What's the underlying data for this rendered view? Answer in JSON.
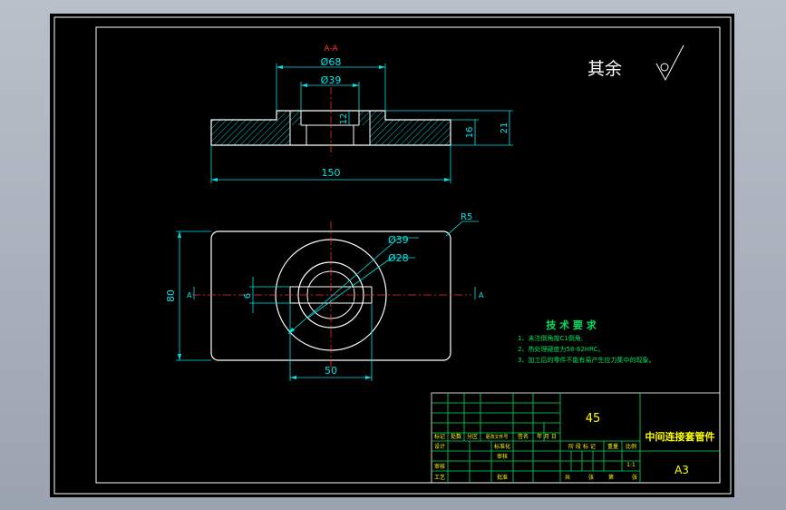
{
  "view": {
    "section_label": "A-A",
    "roughness_note": "其余",
    "surface_finish_symbol": "roughness-check-icon"
  },
  "section_view": {
    "dim_outer_dia": "Ø68",
    "dim_inner_dia": "Ø39",
    "dim_depth": "12",
    "dim_thickness": "16",
    "dim_total_height": "21",
    "dim_length": "150"
  },
  "top_view": {
    "dim_radius": "R5",
    "dim_dia_39": "Ø39",
    "dim_dia_28": "Ø28",
    "dim_width": "80",
    "dim_slot": "6",
    "dim_slot_length": "50",
    "cut_mark_left": "A",
    "cut_mark_right": "A"
  },
  "tech_requirements": {
    "title": "技 术 要 求",
    "items": [
      "1、未注倒角按C1倒角;",
      "2、热处理硬度为58-62HRC。",
      "3、加工后的零件不能有易产生应力集中的现象。"
    ]
  },
  "title_block": {
    "material": "45",
    "part_name": "中间连接套管件",
    "sheet_size": "A3",
    "scale": "1:1",
    "header_cols": [
      "标记",
      "处数",
      "分区",
      "更改文件号",
      "签名",
      "年 月 日"
    ],
    "row_design": "设计",
    "row_standard": "标准化",
    "row_check": "审核",
    "row_process": "工艺",
    "row_approve": "批准",
    "stage_labels": [
      "阶 段 标 记",
      "重量",
      "比例"
    ],
    "sheet_labels": [
      "共",
      "张",
      "第",
      "张"
    ]
  },
  "colors": {
    "background": "#000000",
    "outline": "#ffffff",
    "dimension": "#00e5e5",
    "hatch": "#00c8c8",
    "centerline": "#ff2a2a",
    "tech_text": "#00e060",
    "table": "#00e060",
    "table_text": "#ffff00"
  }
}
